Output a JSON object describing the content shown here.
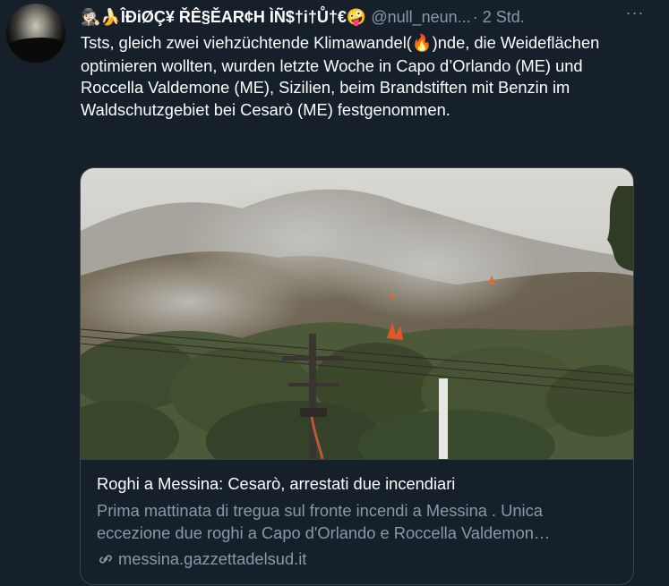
{
  "tweet": {
    "display_name": "🕵🏻🍌ÎĐiØÇ¥ ŘÊ§ĚAR¢H ÌÑ$†i†Ů†€🤪",
    "handle": "@null_neun...",
    "dot": "·",
    "time": "2 Std.",
    "more_label": "···",
    "text_part1": "Tsts, gleich zwei viehzüchtende Klimawandel(",
    "fire_emoji": "🔥",
    "text_part2": ")nde, die Weideflächen optimieren wollten, wurden letzte Woche in Capo d’Orlando (ME) und Roccella Valdemone (ME), Sizilien, beim Brandstiften mit Benzin im Waldschutzgebiet bei Cesarò (ME) festgenommen."
  },
  "card": {
    "title": "Roghi a Messina: Cesarò, arrestati due incendiari",
    "description": "Prima mattinata di tregua sul fronte incendi a Messina . Unica eccezione due roghi a Capo d'Orlando e Roccella Valdemon…",
    "domain": "messina.gazzettadelsud.it"
  },
  "icons": {
    "more": "more-horizontal-icon",
    "link": "link-icon",
    "fire": "fire-emoji-icon"
  },
  "colors": {
    "background": "#15202b",
    "text_primary": "#ffffff",
    "text_secondary": "#8b98a5",
    "border": "#38444d"
  }
}
